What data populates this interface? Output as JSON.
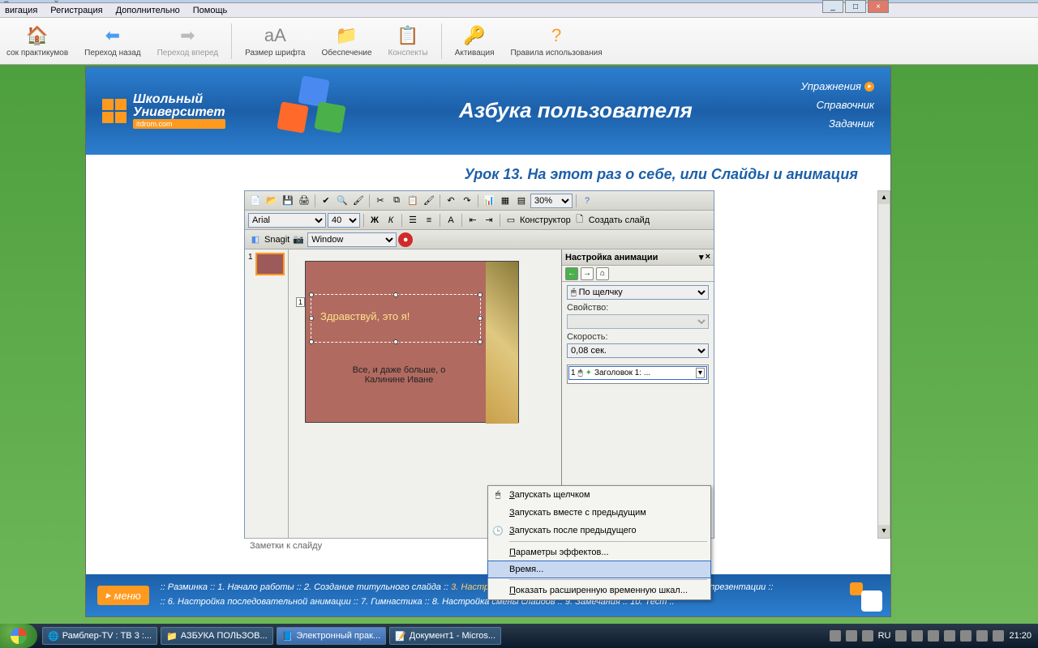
{
  "window_title": "Электронный практикум",
  "menubar": [
    "вигация",
    "Регистрация",
    "Дополнительно",
    "Помощь"
  ],
  "toolbar": [
    {
      "icon": "🏠",
      "label": "сок практикумов",
      "color": "#ff9a1f"
    },
    {
      "icon": "⬅",
      "label": "Переход назад",
      "color": "#4a9cf0"
    },
    {
      "icon": "➡",
      "label": "Переход вперед",
      "color": "#bbb",
      "disabled": true
    },
    {
      "sep": true
    },
    {
      "icon": "aA",
      "label": "Размер шрифта",
      "color": "#888"
    },
    {
      "icon": "📁",
      "label": "Обеспечение",
      "color": "#ff9a1f"
    },
    {
      "icon": "📋",
      "label": "Конспекты",
      "color": "#bbb",
      "disabled": true
    },
    {
      "sep": true
    },
    {
      "icon": "🔑",
      "label": "Активация",
      "color": "#ff9a1f"
    },
    {
      "icon": "?",
      "label": "Правила использования",
      "color": "#ff9a1f"
    }
  ],
  "banner": {
    "logo_line1": "Школьный",
    "logo_line2": "Университет",
    "logo_sub": "itdrom.com",
    "title": "Азбука пользователя",
    "links": [
      "Упражнения",
      "Справочник",
      "Задачник"
    ]
  },
  "lesson_title": "Урок 13. На этот раз о себе, или Слайды и анимация",
  "ppt": {
    "font_name": "Arial",
    "font_size": "40",
    "zoom": "30%",
    "snagit_label": "Snagit",
    "snagit_window": "Window",
    "constructor": "Конструктор",
    "create_slide": "Создать слайд",
    "slide_num": "1",
    "slide_text1": "Здравствуй, это я!",
    "slide_text2": "Все, и даже больше, о Калинине Иване",
    "notes": "Заметки к слайду",
    "taskpane": {
      "title": "Настройка анимации",
      "start_label": "",
      "start_value": "По щелчку",
      "prop_label": "Свойство:",
      "speed_label": "Скорость:",
      "speed_value": "0,08 сек.",
      "list_num": "1",
      "list_item": "Заголовок 1: ..."
    }
  },
  "context_menu": [
    {
      "icon": "🖱",
      "label": "Запускать щелчком"
    },
    {
      "icon": "",
      "label": "Запускать вместе с предыдущим"
    },
    {
      "icon": "🕒",
      "label": "Запускать после предыдущего"
    },
    {
      "sep": true
    },
    {
      "icon": "",
      "label": "Параметры эффектов..."
    },
    {
      "icon": "",
      "label": "Время...",
      "hl": true
    },
    {
      "sep": true
    },
    {
      "icon": "",
      "label": "Показать расширенную временную шкалу",
      "cut": true
    }
  ],
  "bottom": {
    "menu": "меню",
    "steps_line1": ":: Разминка :: 1. Начало работы :: 2. Создание титульного слайда :: |3. Настройка анимации| :: 4. Вставка рисунка :: 5. Просмотр презентации ::",
    "steps_line2": ":: 6. Настройка последовательной анимации :: 7. Гимнастика :: 8. Настройка смены слайдов :: 9. Замечания :: 10. Тест ::"
  },
  "taskbar": {
    "items": [
      {
        "icon": "🌐",
        "label": "Рамблер-TV : ТВ 3 :..."
      },
      {
        "icon": "📁",
        "label": "АЗБУКА ПОЛЬЗОВ...",
        "active": false
      },
      {
        "icon": "📘",
        "label": "Электронный прак...",
        "active": true
      },
      {
        "icon": "📝",
        "label": "Документ1 - Micros..."
      }
    ],
    "lang": "RU",
    "time": "21:20"
  }
}
